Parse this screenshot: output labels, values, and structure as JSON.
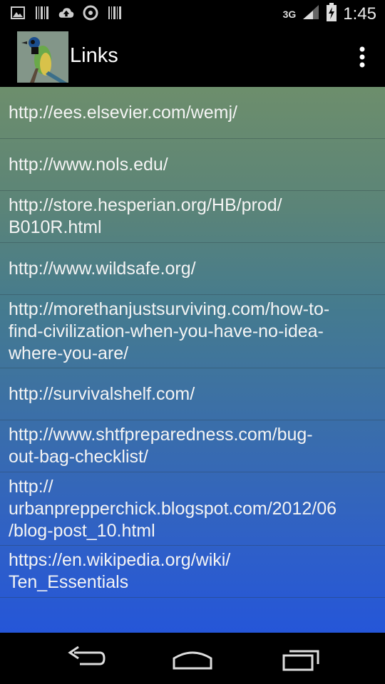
{
  "status_bar": {
    "time": "1:45",
    "network": "3G",
    "left_icons": [
      "image-icon",
      "barcode-icon",
      "cloud-upload-icon",
      "sync-icon",
      "barcode-icon"
    ]
  },
  "action_bar": {
    "title": "Links",
    "icon": "bird-app-icon"
  },
  "links": [
    "http://ees.elsevier.com/wemj/",
    "http://www.nols.edu/",
    "http://store.hesperian.org/HB/prod/B010R.html",
    "http://www.wildsafe.org/",
    "http://morethanjustsurviving.com/how-to-find-civilization-when-you-have-no-idea-where-you-are/",
    "http://survivalshelf.com/",
    "http://www.shtfpreparedness.com/bug-out-bag-checklist/",
    "http://urbanprepperchick.blogspot.com/2012/06/blog-post_10.html",
    "https://en.wikipedia.org/wiki/Ten_Essentials"
  ],
  "links_display": [
    [
      "http://ees.elsevier.com/wemj/"
    ],
    [
      "http://www.nols.edu/"
    ],
    [
      "http://store.hesperian.org/HB/prod/",
      "B010R.html"
    ],
    [
      "http://www.wildsafe.org/"
    ],
    [
      "http://morethanjustsurviving.com/how-to-",
      "find-civilization-when-you-have-no-idea-",
      "where-you-are/"
    ],
    [
      "http://survivalshelf.com/"
    ],
    [
      "http://www.shtfpreparedness.com/bug-",
      "out-bag-checklist/"
    ],
    [
      "http://",
      "urbanprepperchick.blogspot.com/2012/06",
      "/blog-post_10.html"
    ],
    [
      "https://en.wikipedia.org/wiki/",
      "Ten_Essentials"
    ]
  ],
  "nav_bar": {
    "buttons": [
      "back-icon",
      "home-icon",
      "recent-apps-icon"
    ]
  }
}
